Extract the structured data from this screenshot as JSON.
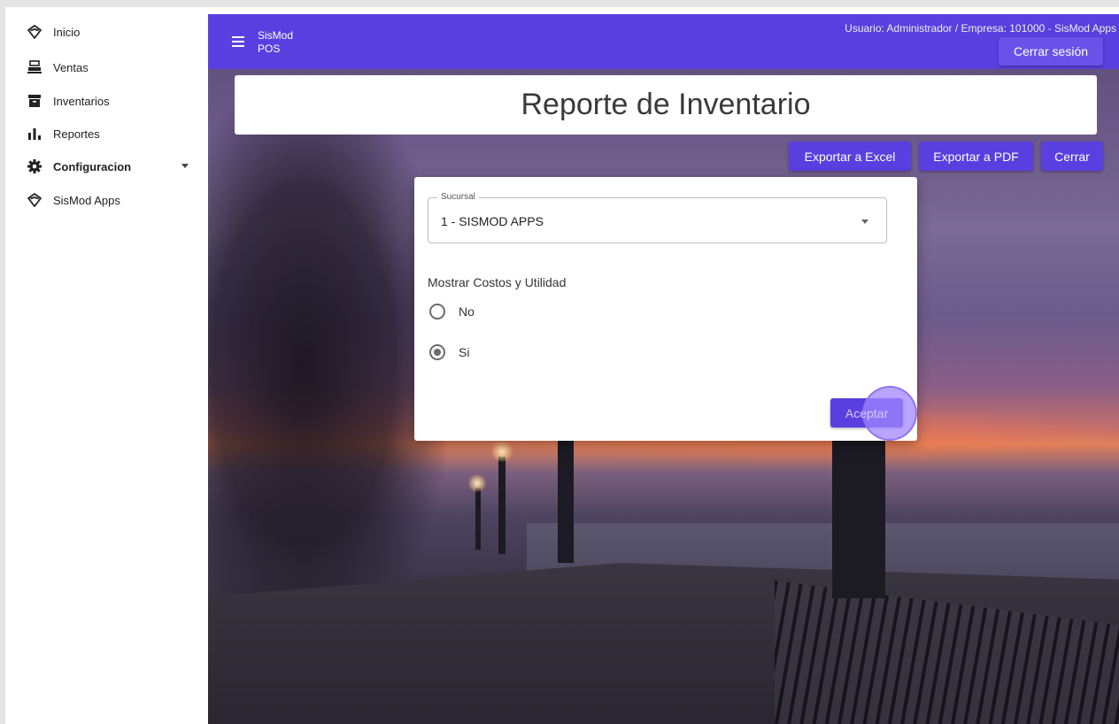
{
  "sidebar": {
    "items": [
      {
        "label": "Inicio",
        "icon": "sismod-logo-icon"
      },
      {
        "label": "Ventas",
        "icon": "cash-register-icon"
      },
      {
        "label": "Inventarios",
        "icon": "archive-box-icon"
      },
      {
        "label": "Reportes",
        "icon": "bar-chart-icon"
      },
      {
        "label": "Configuracion",
        "icon": "gear-icon"
      },
      {
        "label": "SisMod Apps",
        "icon": "sismod-logo-icon"
      }
    ]
  },
  "header": {
    "app_name_line1": "SisMod",
    "app_name_line2": "POS",
    "user_info": "Usuario: Administrador / Empresa: 101000 - SisMod Apps",
    "logout_label": "Cerrar sesión",
    "accent_color": "#5a3fe0"
  },
  "page": {
    "title": "Reporte de Inventario"
  },
  "actions": {
    "export_excel": "Exportar a Excel",
    "export_pdf": "Exportar a PDF",
    "close": "Cerrar"
  },
  "dialog": {
    "branch_label": "Sucursal",
    "branch_value": "1 - SISMOD APPS",
    "costs_label": "Mostrar Costos y Utilidad",
    "options": [
      {
        "label": "No",
        "selected": false
      },
      {
        "label": "Si",
        "selected": true
      }
    ],
    "accept_label": "Aceptar"
  }
}
